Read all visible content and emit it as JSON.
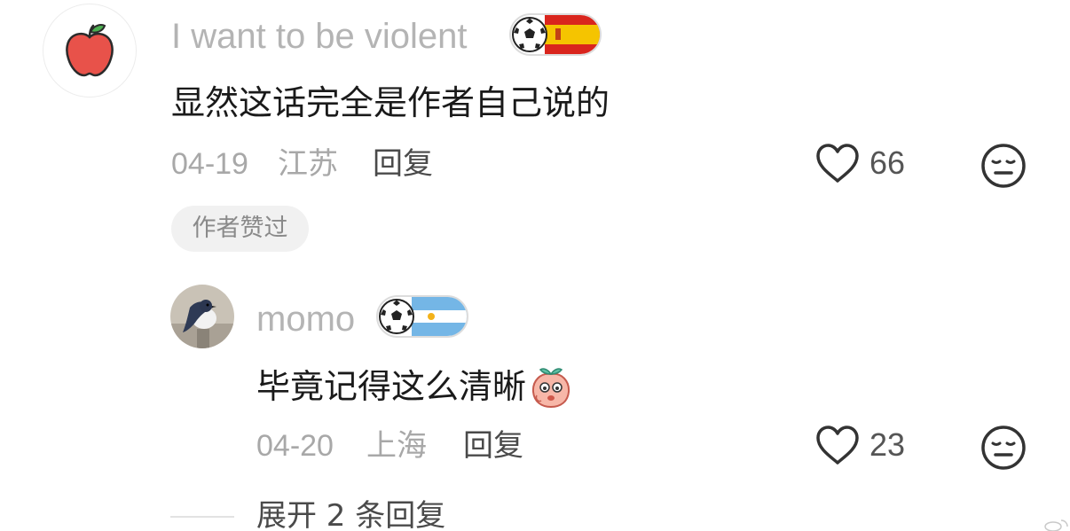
{
  "comments": [
    {
      "username": "I want to be violent",
      "avatar_icon": "apple-icon",
      "badge": {
        "icon": "soccer-ball-icon",
        "flag": "spain-flag-icon"
      },
      "text": "显然这话完全是作者自己说的",
      "date": "04-19",
      "location": "江苏",
      "reply_label": "回复",
      "likes": "66",
      "tag": "作者赞过"
    }
  ],
  "replies": [
    {
      "username": "momo",
      "avatar_icon": "bird-photo-avatar",
      "badge": {
        "icon": "soccer-ball-icon",
        "flag": "argentina-flag-icon"
      },
      "text": "毕竟记得这么清晰",
      "emoji_icon": "peach-emoji-icon",
      "date": "04-20",
      "location": "上海",
      "reply_label": "回复",
      "likes": "23"
    }
  ],
  "expand_label": "展开 2 条回复",
  "colors": {
    "username": "#b4b4b4",
    "meta": "#a8a8a8",
    "text": "#1a1a1a",
    "tag_bg": "#f1f1f1",
    "apple": "#e8524a",
    "spain_red": "#d9251d",
    "spain_yellow": "#f5c400",
    "argentina_blue": "#74b6e6"
  }
}
